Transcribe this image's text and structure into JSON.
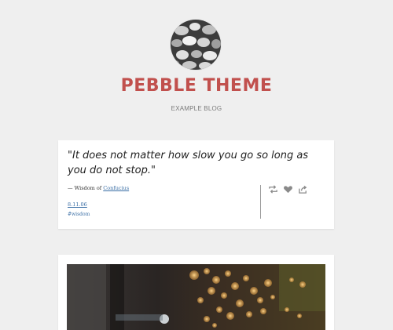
{
  "header": {
    "title": "PEBBLE THEME",
    "description": "EXAMPLE BLOG"
  },
  "quote_post": {
    "quote": "\"It does not matter how slow you go so long as you do not stop.\"",
    "source_prefix": "— Wisdom of ",
    "source_link": "Confucius",
    "date": "8.11.06",
    "tag": "#wisdom",
    "actions": {
      "reblog_icon": "reblog-icon",
      "like_icon": "heart-icon",
      "share_icon": "share-icon"
    }
  },
  "photo_post": {
    "image": "bokeh-lights-photo"
  },
  "colors": {
    "background": "#efefef",
    "title": "#c1504d",
    "link": "#3a6ea5",
    "icon": "#8a8a8a"
  }
}
